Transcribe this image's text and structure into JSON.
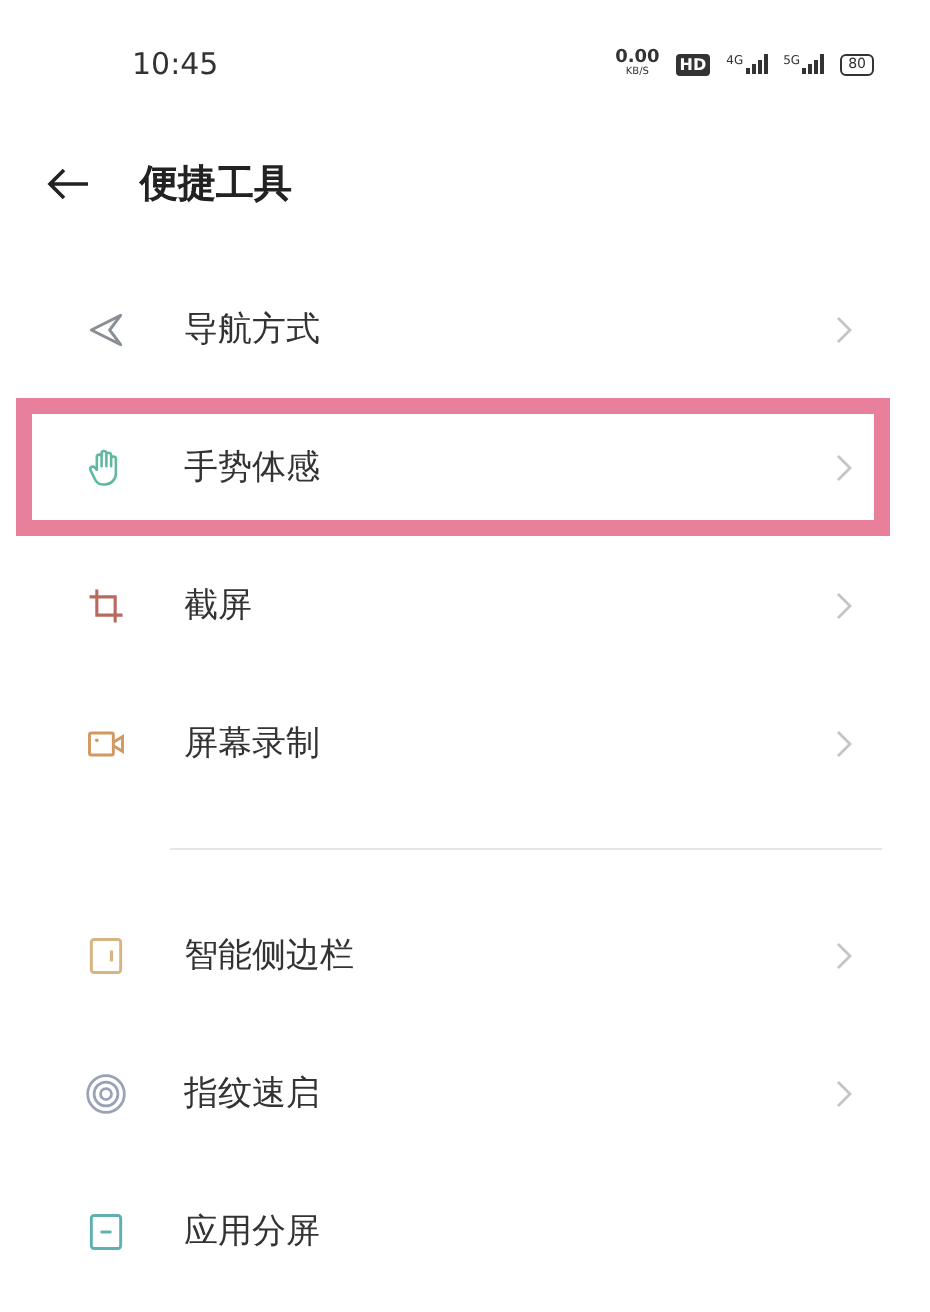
{
  "status_bar": {
    "time": "10:45",
    "net_speed": "0.00",
    "net_unit": "KB/S",
    "hd_badge": "HD",
    "signals": [
      {
        "label": "4G"
      },
      {
        "label": "5G"
      }
    ],
    "battery": "80"
  },
  "header": {
    "title": "便捷工具"
  },
  "groups": [
    {
      "items": [
        {
          "kind": "navigation",
          "label": "导航方式",
          "chevron": true,
          "highlighted": false
        },
        {
          "kind": "hand",
          "label": "手势体感",
          "chevron": true,
          "highlighted": true
        },
        {
          "kind": "crop",
          "label": "截屏",
          "chevron": true,
          "highlighted": false
        },
        {
          "kind": "video",
          "label": "屏幕录制",
          "chevron": true,
          "highlighted": false
        }
      ]
    },
    {
      "items": [
        {
          "kind": "sidebar",
          "label": "智能侧边栏",
          "chevron": true,
          "highlighted": false
        },
        {
          "kind": "fingerprint",
          "label": "指纹速启",
          "chevron": true,
          "highlighted": false
        },
        {
          "kind": "split",
          "label": "应用分屏",
          "chevron": false,
          "highlighted": false
        }
      ]
    }
  ]
}
